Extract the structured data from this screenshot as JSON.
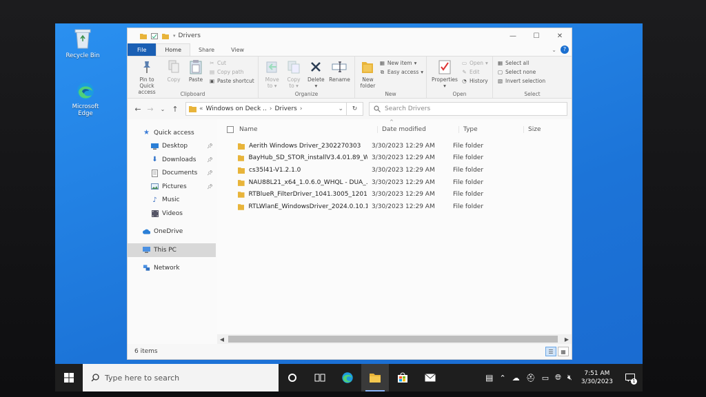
{
  "desktop": {
    "icons": [
      {
        "label": "Recycle Bin"
      },
      {
        "label": "Microsoft Edge"
      }
    ]
  },
  "window": {
    "title": "Drivers",
    "controls": {
      "minimize": "—",
      "maximize": "☐",
      "close": "✕"
    }
  },
  "ribbon_tabs": [
    {
      "label": "File"
    },
    {
      "label": "Home"
    },
    {
      "label": "Share"
    },
    {
      "label": "View"
    }
  ],
  "ribbon": {
    "clipboard": {
      "group": "Clipboard",
      "pin": "Pin to Quick access",
      "copy": "Copy",
      "paste": "Paste",
      "cut": "Cut",
      "copy_path": "Copy path",
      "paste_shortcut": "Paste shortcut"
    },
    "organize": {
      "group": "Organize",
      "move_to": "Move to",
      "copy_to": "Copy to",
      "delete": "Delete",
      "rename": "Rename"
    },
    "new": {
      "group": "New",
      "new_folder": "New folder",
      "new_item": "New item",
      "easy_access": "Easy access"
    },
    "open": {
      "group": "Open",
      "properties": "Properties",
      "open": "Open",
      "edit": "Edit",
      "history": "History"
    },
    "select": {
      "group": "Select",
      "select_all": "Select all",
      "select_none": "Select none",
      "invert": "Invert selection"
    }
  },
  "address": {
    "overflow": "«",
    "crumbs": [
      "Windows on Deck ..",
      "Drivers"
    ],
    "search_placeholder": "Search Drivers"
  },
  "nav_pane": {
    "quick_access": "Quick access",
    "items": [
      {
        "label": "Desktop",
        "pinned": true
      },
      {
        "label": "Downloads",
        "pinned": true
      },
      {
        "label": "Documents",
        "pinned": true
      },
      {
        "label": "Pictures",
        "pinned": true
      },
      {
        "label": "Music",
        "pinned": false
      },
      {
        "label": "Videos",
        "pinned": false
      }
    ],
    "onedrive": "OneDrive",
    "this_pc": "This PC",
    "network": "Network"
  },
  "columns": {
    "name": "Name",
    "date": "Date modified",
    "type": "Type",
    "size": "Size"
  },
  "files": [
    {
      "name": "Aerith Windows Driver_2302270303",
      "date": "3/30/2023 12:29 AM",
      "type": "File folder"
    },
    {
      "name": "BayHub_SD_STOR_installV3.4.01.89_W...",
      "date": "3/30/2023 12:29 AM",
      "type": "File folder"
    },
    {
      "name": "cs35l41-V1.2.1.0",
      "date": "3/30/2023 12:29 AM",
      "type": "File folder"
    },
    {
      "name": "NAU88L21_x64_1.0.6.0_WHQL - DUA_...",
      "date": "3/30/2023 12:29 AM",
      "type": "File folder"
    },
    {
      "name": "RTBlueR_FilterDriver_1041.3005_1201...",
      "date": "3/30/2023 12:29 AM",
      "type": "File folder"
    },
    {
      "name": "RTLWlanE_WindowsDriver_2024.0.10.1...",
      "date": "3/30/2023 12:29 AM",
      "type": "File folder"
    }
  ],
  "status": {
    "count": "6 items"
  },
  "taskbar": {
    "search_placeholder": "Type here to search",
    "time": "7:51 AM",
    "date": "3/30/2023",
    "notifications": "1"
  },
  "colors": {
    "desktop": "#1f7ee0",
    "file_tab": "#1a5fb4",
    "folder": "#e8b43a",
    "taskbar": "#1e1e1e"
  }
}
